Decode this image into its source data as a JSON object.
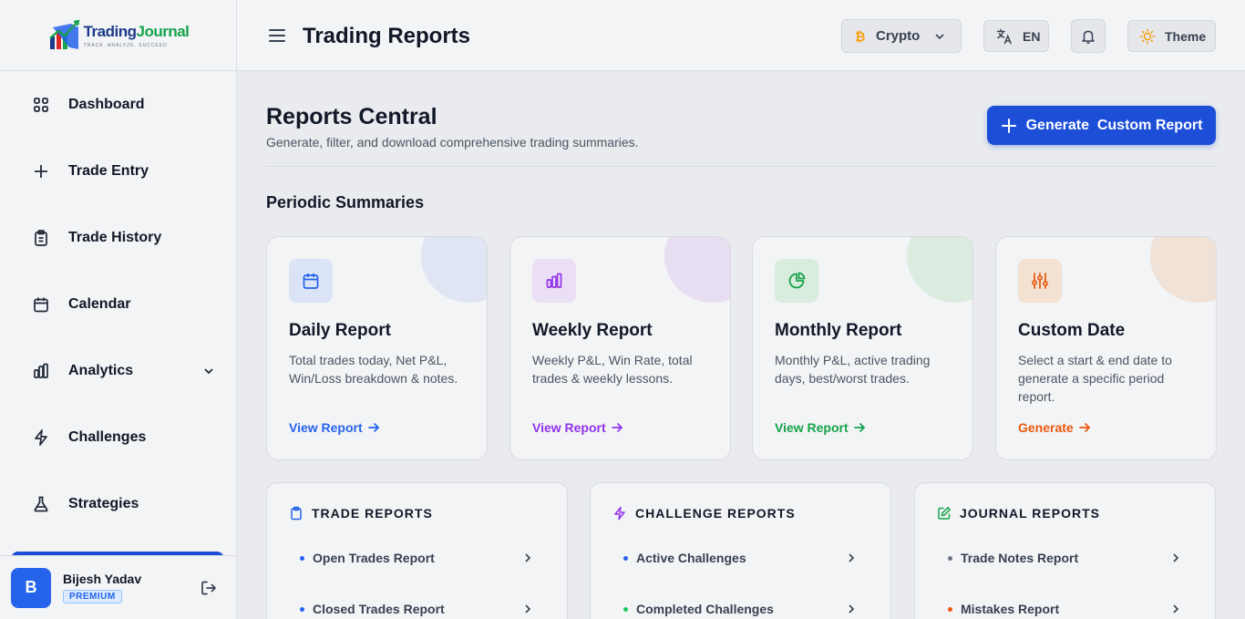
{
  "brand": {
    "logo_text_1": "Trading",
    "logo_text_2": "Journal",
    "logo_tagline": "TRACK. ANALYZE. SUCCEED"
  },
  "sidebar": {
    "items": [
      {
        "label": "Dashboard",
        "icon": "grid-icon"
      },
      {
        "label": "Trade Entry",
        "icon": "plus-icon"
      },
      {
        "label": "Trade History",
        "icon": "clipboard-icon"
      },
      {
        "label": "Calendar",
        "icon": "calendar-icon"
      },
      {
        "label": "Analytics",
        "icon": "bar-chart-icon"
      },
      {
        "label": "Challenges",
        "icon": "lightning-icon"
      },
      {
        "label": "Strategies",
        "icon": "flask-icon"
      }
    ]
  },
  "user": {
    "initial": "B",
    "name": "Bijesh Yadav",
    "badge": "PREMIUM"
  },
  "header": {
    "title": "Trading Reports",
    "market": "Crypto",
    "language": "EN",
    "theme_label": "Theme"
  },
  "main": {
    "title": "Reports Central",
    "subtitle": "Generate, filter, and download comprehensive trading summaries.",
    "generate_button": "Generate  Custom Report",
    "periodic_title": "Periodic Summaries",
    "cards": [
      {
        "title": "Daily Report",
        "description": "Total trades today, Net P&L, Win/Loss breakdown & notes.",
        "link": "View Report",
        "color": "#2563eb"
      },
      {
        "title": "Weekly Report",
        "description": "Weekly P&L, Win Rate, total trades & weekly lessons.",
        "link": "View Report",
        "color": "#9333ea"
      },
      {
        "title": "Monthly Report",
        "description": "Monthly P&L, active trading days, best/worst trades.",
        "link": "View Report",
        "color": "#16a34a"
      },
      {
        "title": "Custom Date",
        "description": "Select a start & end date to generate a specific period report.",
        "link": "Generate",
        "color": "#ea580c"
      }
    ],
    "report_groups": [
      {
        "title": "TRADE REPORTS",
        "items": [
          "Open Trades Report",
          "Closed Trades Report"
        ]
      },
      {
        "title": "CHALLENGE REPORTS",
        "items": [
          "Active Challenges",
          "Completed Challenges"
        ]
      },
      {
        "title": "JOURNAL REPORTS",
        "items": [
          "Trade Notes Report",
          "Mistakes Report"
        ]
      }
    ]
  }
}
